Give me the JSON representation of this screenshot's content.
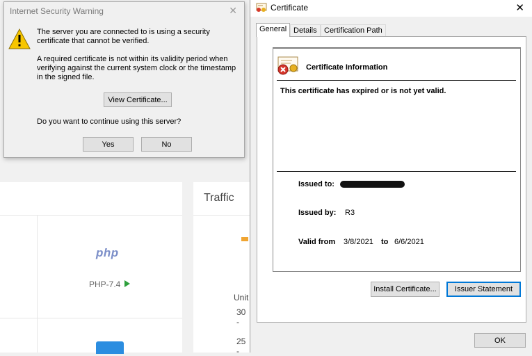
{
  "background_page": {
    "traffic_title": "Traffic",
    "php_logo": "php",
    "php_version": "PHP-7.4",
    "axis_label_partial": "Unit",
    "axis_tick_30": "30 -",
    "axis_tick_25": "25 -"
  },
  "warning_dialog": {
    "title": "Internet Security Warning",
    "message1": "The server you are connected to is using a security certificate that cannot be verified.",
    "message2": "A required certificate is not within its validity period when verifying against the current system clock or the timestamp in the signed file.",
    "view_certificate_button": "View Certificate...",
    "question": "Do you want to continue using this server?",
    "yes_button": "Yes",
    "no_button": "No"
  },
  "certificate_dialog": {
    "title": "Certificate",
    "tabs": [
      {
        "label": "General",
        "active": true
      },
      {
        "label": "Details",
        "active": false
      },
      {
        "label": "Certification Path",
        "active": false
      }
    ],
    "info_heading": "Certificate Information",
    "status_message": "This certificate has expired or is not yet valid.",
    "issued_to_label": "Issued to:",
    "issued_by_label": "Issued by:",
    "issued_by_value": "R3",
    "valid_from_label": "Valid from",
    "valid_from_value": "3/8/2021",
    "valid_to_label": "to",
    "valid_to_value": "6/6/2021",
    "install_button": "Install Certificate...",
    "issuer_statement_button": "Issuer Statement",
    "ok_button": "OK"
  },
  "colors": {
    "warning_yellow": "#f7c600",
    "accent_blue": "#0078d7",
    "php_play_green": "#2ea03c",
    "traffic_bar_orange": "#f0a532"
  }
}
